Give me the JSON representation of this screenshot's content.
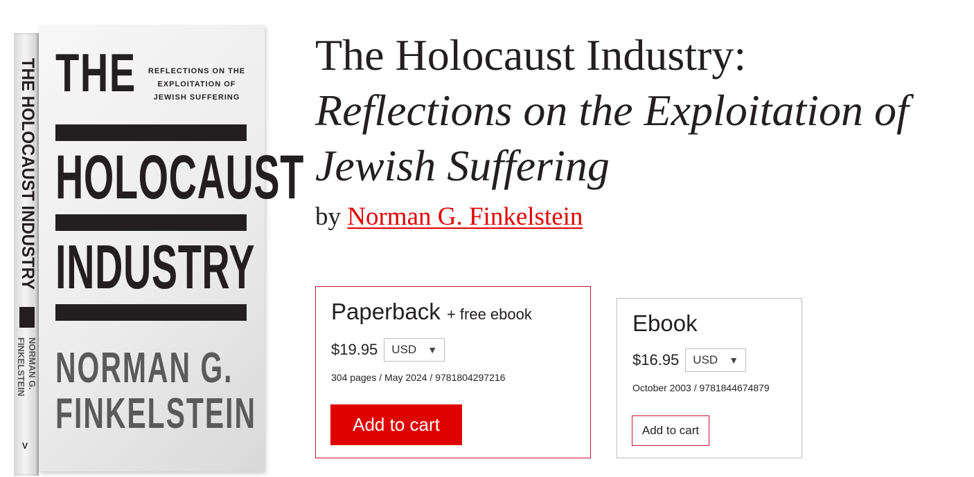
{
  "cover": {
    "spine_title": "THE HOLOCAUST INDUSTRY",
    "spine_author_line1": "NORMAN G.",
    "spine_author_line2": "FINKELSTEIN",
    "spine_logo": "V",
    "the": "THE",
    "subtitle_line1": "REFLECTIONS ON THE",
    "subtitle_line2": "EXPLOITATION OF",
    "subtitle_line3": "JEWISH SUFFERING",
    "word_holocaust": "HOLOCAUST",
    "word_industry": "INDUSTRY",
    "author_line1": "NORMAN G.",
    "author_line2": "FINKELSTEIN"
  },
  "book": {
    "title": "The Holocaust Industry:",
    "subtitle_line1": "Reflections on the Exploitation of",
    "subtitle_line2": "Jewish Suffering",
    "by": "by",
    "author": "Norman G. Finkelstein"
  },
  "formats": [
    {
      "name": "Paperback",
      "extra": "+ free ebook",
      "price": "$19.95",
      "currency": "USD",
      "details": "304 pages / May 2024 / 9781804297216",
      "button": "Add to cart"
    },
    {
      "name": "Ebook",
      "price": "$16.95",
      "currency": "USD",
      "details": "October 2003 / 9781844674879",
      "button": "Add to cart"
    }
  ],
  "colors": {
    "accent": "#e00000",
    "text": "#231f20",
    "border_primary": "#c8102e",
    "border_secondary": "#bdbdbd"
  },
  "icons": {
    "caret": "caret-down-icon"
  }
}
